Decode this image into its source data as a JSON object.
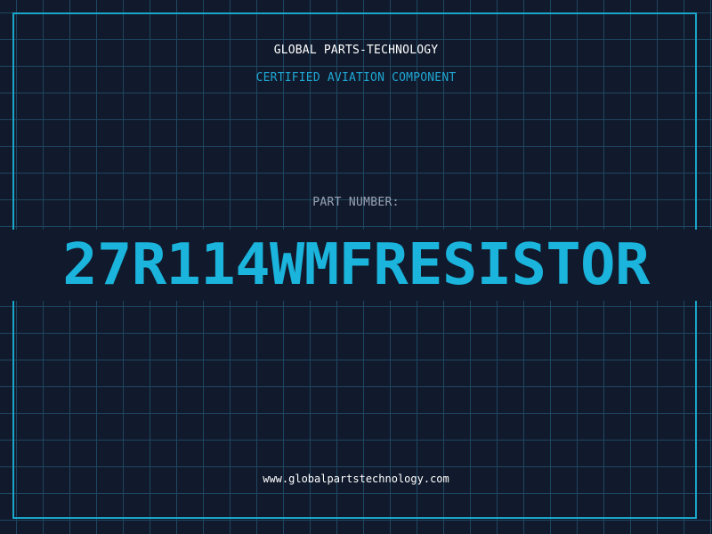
{
  "header": {
    "brand": "GLOBAL PARTS-TECHNOLOGY",
    "subtitle": "CERTIFIED AVIATION COMPONENT"
  },
  "part": {
    "label": "PART NUMBER:",
    "number": "27R114WMFRESISTOR"
  },
  "footer": {
    "website": "www.globalpartstechnology.com"
  },
  "colors": {
    "background": "#111a2c",
    "grid": "#1e4660",
    "accent": "#1ab4dc",
    "frame": "#1aa6c8",
    "label": "#9aa3b5",
    "text": "#ffffff"
  }
}
